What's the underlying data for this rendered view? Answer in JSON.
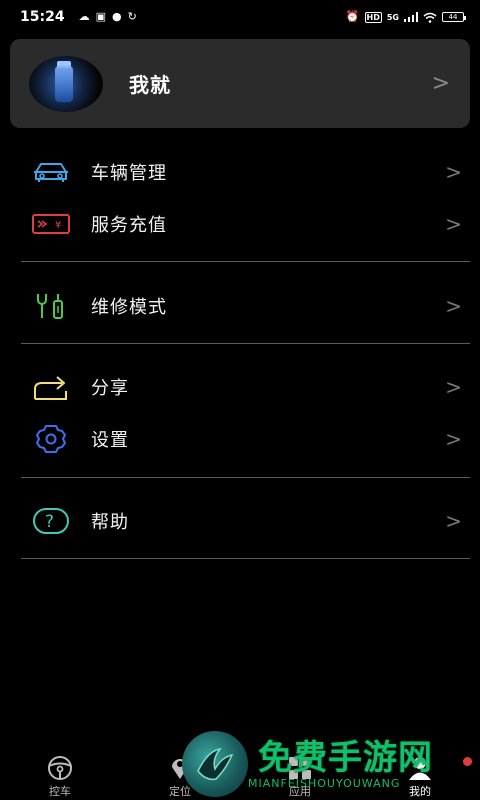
{
  "status_bar": {
    "time": "15:24",
    "left_icons": [
      "app-icon",
      "photo-icon",
      "chat-icon",
      "sync-icon"
    ],
    "right": {
      "hd": "HD",
      "network": "5G",
      "battery": "44"
    }
  },
  "profile": {
    "name": "我就"
  },
  "menu": {
    "groups": [
      [
        {
          "label": "车辆管理",
          "icon": "car-icon",
          "color": "#3fa6e8"
        },
        {
          "label": "服务充值",
          "icon": "ticket-icon",
          "color": "#e0403c"
        }
      ],
      [
        {
          "label": "维修模式",
          "icon": "wrench-icon",
          "color": "#4ccb4c"
        }
      ],
      [
        {
          "label": "分享",
          "icon": "share-icon",
          "color": "#f1e07a"
        },
        {
          "label": "设置",
          "icon": "gear-icon",
          "color": "#3e6ff0"
        }
      ],
      [
        {
          "label": "帮助",
          "icon": "help-icon",
          "color": "#3fc9b8"
        }
      ]
    ]
  },
  "bottom_nav": [
    {
      "label": "控车",
      "icon": "steering-wheel-icon"
    },
    {
      "label": "定位",
      "icon": "location-icon"
    },
    {
      "label": "应用",
      "icon": "apps-icon"
    },
    {
      "label": "我的",
      "icon": "profile-icon",
      "active": true
    }
  ],
  "watermark": {
    "title": "免费手游网",
    "subtitle": "MIANFEISHOUYOUWANG"
  }
}
